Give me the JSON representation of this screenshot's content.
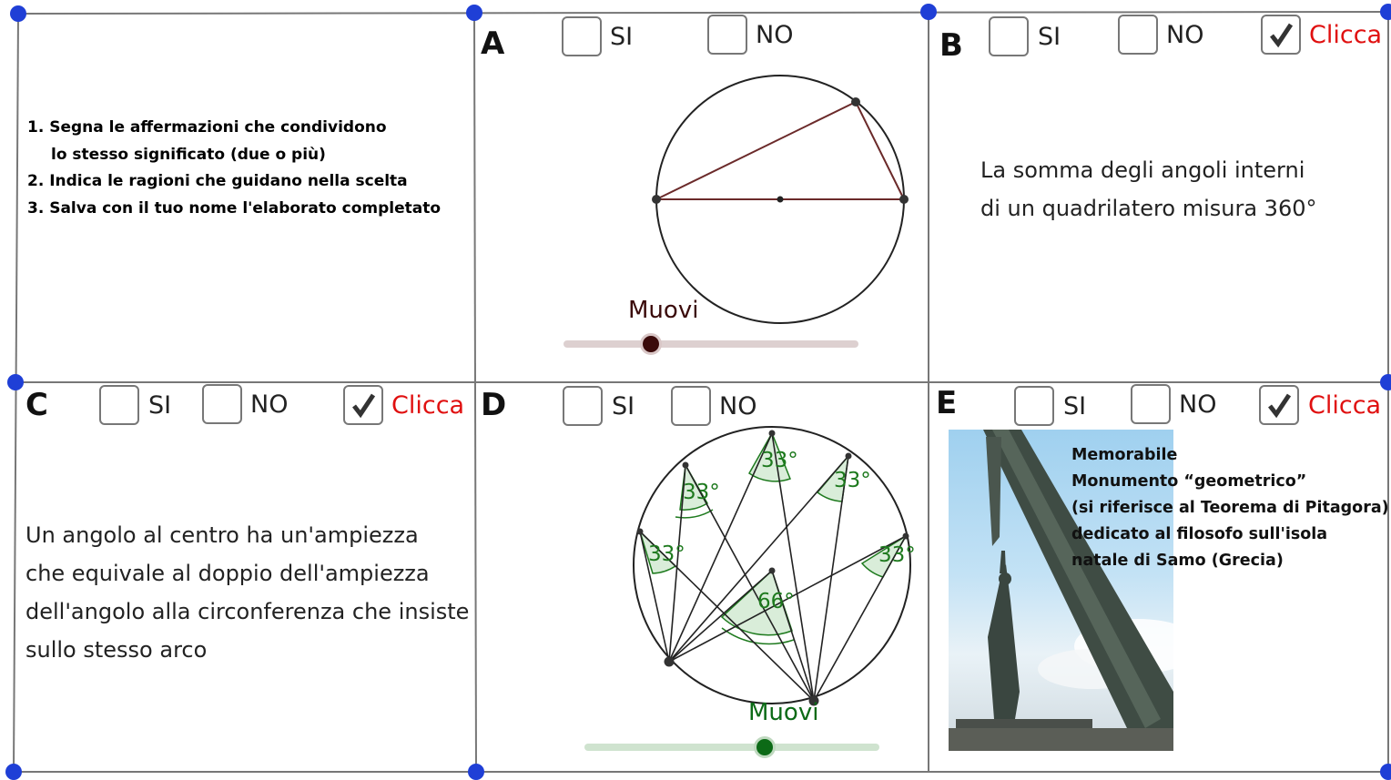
{
  "instructions": {
    "line1": "1. Segna le affermazioni che condividono",
    "line1b": "lo stesso significato (due o più)",
    "line2": "2. Indica le ragioni  che guidano nella scelta",
    "line3": "3. Salva con il tuo nome l'elaborato completato"
  },
  "panels": {
    "A": {
      "letter": "A",
      "si": "SI",
      "no": "NO",
      "slider_label": "Muovi",
      "slider_value": 0.28,
      "slider_color": "#3a0a0a"
    },
    "B": {
      "letter": "B",
      "si": "SI",
      "no": "NO",
      "clicca": "Clicca",
      "clicca_checked": true,
      "text_line1": "La somma degli angoli interni",
      "text_line2": "di un quadrilatero misura 360°"
    },
    "C": {
      "letter": "C",
      "si": "SI",
      "no": "NO",
      "clicca": "Clicca",
      "clicca_checked": true,
      "text_line1": "Un angolo al centro ha un'ampiezza",
      "text_line2": "che equivale al doppio dell'ampiezza",
      "text_line3": "dell'angolo alla circonferenza che insiste",
      "text_line4": "sullo stesso arco"
    },
    "D": {
      "letter": "D",
      "si": "SI",
      "no": "NO",
      "slider_label": "Muovi",
      "slider_value": 0.62,
      "slider_color": "#0c6a16",
      "inscribed_angle_label": "33°",
      "central_angle_label": "66°"
    },
    "E": {
      "letter": "E",
      "si": "SI",
      "no": "NO",
      "clicca": "Clicca",
      "clicca_checked": true,
      "caption_line1": "Memorabile",
      "caption_line2": "Monumento “geometrico”",
      "caption_line3": "(si riferisce al Teorema di Pitagora)",
      "caption_line4": "dedicato al filosofo sull'isola",
      "caption_line5": "natale di Samo (Grecia)"
    }
  },
  "colors": {
    "grid_line": "#777777",
    "corner_point": "#1f3fd6",
    "clicca": "#e01010",
    "angle_fill": "#cfe9cf",
    "angle_stroke": "#1e7a1e"
  }
}
